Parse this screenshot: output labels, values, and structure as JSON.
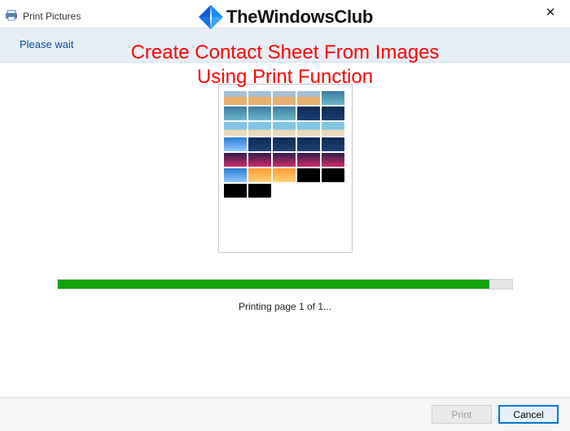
{
  "window": {
    "title": "Print Pictures",
    "close_symbol": "✕"
  },
  "branding": {
    "text": "TheWindowsClub"
  },
  "subheader": {
    "please_wait": "Please wait"
  },
  "overlay": {
    "line1": "Create Contact Sheet From Images",
    "line2": "Using Print Function"
  },
  "progress": {
    "percent": 95,
    "status_text": "Printing page 1 of 1..."
  },
  "footer": {
    "print_label": "Print",
    "cancel_label": "Cancel"
  }
}
